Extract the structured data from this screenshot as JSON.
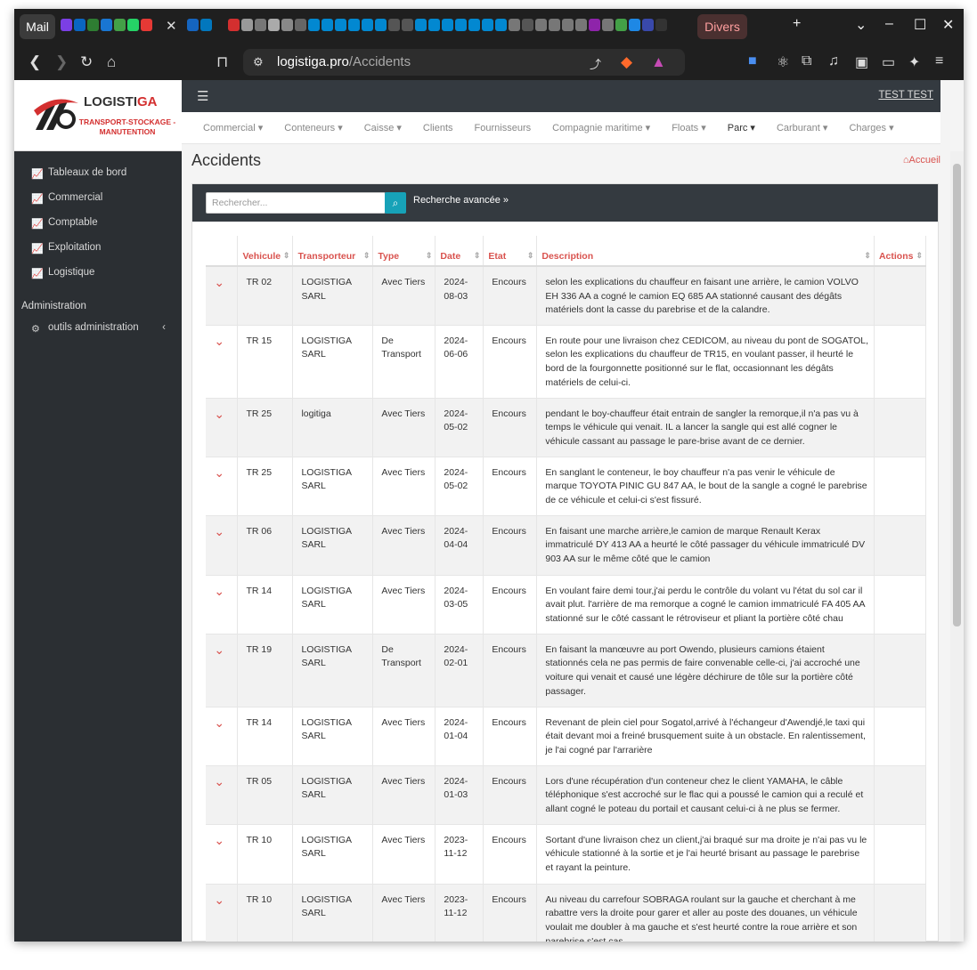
{
  "browser": {
    "tab_mail": "Mail",
    "tab_group": "Divers",
    "url_host": "logistiga.pro",
    "url_path": "/Accidents"
  },
  "app": {
    "logo_name_a": "LOGISTI",
    "logo_name_b": "GA",
    "logo_sub": "TRANSPORT-STOCKAGE -MANUTENTION",
    "user": "TEST TEST",
    "sidebar": [
      {
        "label": "Tableaux de bord"
      },
      {
        "label": "Commercial"
      },
      {
        "label": "Comptable"
      },
      {
        "label": "Exploitation"
      },
      {
        "label": "Logistique"
      }
    ],
    "admin_section": "Administration",
    "admin_item": "outils administration",
    "subnav": [
      {
        "label": "Commercial ▾"
      },
      {
        "label": "Conteneurs ▾"
      },
      {
        "label": "Caisse ▾"
      },
      {
        "label": "Clients"
      },
      {
        "label": "Fournisseurs"
      },
      {
        "label": "Compagnie maritime ▾"
      },
      {
        "label": "Floats ▾"
      },
      {
        "label": "Parc ▾"
      },
      {
        "label": "Carburant ▾"
      },
      {
        "label": "Charges ▾"
      }
    ],
    "page_title": "Accidents",
    "home_link": "Accueil",
    "search_placeholder": "Rechercher...",
    "advanced_search": "Recherche avancée »"
  },
  "table": {
    "headers": [
      "Vehicule",
      "Transporteur",
      "Type",
      "Date",
      "Etat",
      "Description",
      "Actions"
    ],
    "rows": [
      {
        "vehicule": "TR 02",
        "transporteur": "LOGISTIGA SARL",
        "type": "Avec Tiers",
        "date": "2024-08-03",
        "etat": "Encours",
        "description": "selon les explications du chauffeur en faisant une arrière, le camion VOLVO EH 336 AA a cogné le camion EQ 685 AA stationné causant des dégâts matériels dont la casse du parebrise et de la calandre."
      },
      {
        "vehicule": "TR 15",
        "transporteur": "LOGISTIGA SARL",
        "type": "De Transport",
        "date": "2024-06-06",
        "etat": "Encours",
        "description": "En route pour une livraison chez CEDICOM, au niveau du pont de SOGATOL, selon les explications du chauffeur de TR15, en voulant passer, il heurté le bord de la fourgonnette positionné sur le flat, occasionnant les dégâts matériels de celui-ci."
      },
      {
        "vehicule": "TR 25",
        "transporteur": "logitiga",
        "type": "Avec Tiers",
        "date": "2024-05-02",
        "etat": "Encours",
        "description": "pendant le boy-chauffeur était entrain de sangler la remorque,il n'a pas vu à temps le véhicule qui venait. IL a lancer la sangle qui est allé cogner le véhicule cassant au passage le pare-brise avant de ce dernier."
      },
      {
        "vehicule": "TR 25",
        "transporteur": "LOGISTIGA SARL",
        "type": "Avec Tiers",
        "date": "2024-05-02",
        "etat": "Encours",
        "description": "En sanglant le conteneur, le boy chauffeur n'a pas venir le véhicule de marque TOYOTA PINIC GU 847 AA, le bout de la sangle a cogné le parebrise de ce véhicule et celui-ci s'est fissuré."
      },
      {
        "vehicule": "TR 06",
        "transporteur": "LOGISTIGA SARL",
        "type": "Avec Tiers",
        "date": "2024-04-04",
        "etat": "Encours",
        "description": "En faisant une marche arrière,le camion de marque Renault Kerax immatriculé DY 413 AA a heurté le côté passager du véhicule immatriculé DV 903 AA sur le même côté que le camion"
      },
      {
        "vehicule": "TR 14",
        "transporteur": "LOGISTIGA SARL",
        "type": "Avec Tiers",
        "date": "2024-03-05",
        "etat": "Encours",
        "description": "En voulant faire demi tour,j'ai perdu le contrôle du volant vu l'état du sol car il avait plut. l'arrière de ma remorque a cogné le camion immatriculé FA 405 AA stationné sur le côté cassant le rétroviseur et pliant la portière côté chau"
      },
      {
        "vehicule": "TR 19",
        "transporteur": "LOGISTIGA SARL",
        "type": "De Transport",
        "date": "2024-02-01",
        "etat": "Encours",
        "description": "En faisant la manœuvre au port Owendo, plusieurs camions étaient stationnés cela ne pas permis de faire convenable celle-ci, j'ai accroché une voiture qui venait et causé une légère déchirure de tôle sur la portière côté passager."
      },
      {
        "vehicule": "TR 14",
        "transporteur": "LOGISTIGA SARL",
        "type": "Avec Tiers",
        "date": "2024-01-04",
        "etat": "Encours",
        "description": "Revenant de plein ciel pour Sogatol,arrivé à l'échangeur d'Awendjé,le taxi qui était devant moi a freiné brusquement suite à un obstacle. En ralentissement, je l'ai cogné par l'arrarière"
      },
      {
        "vehicule": "TR 05",
        "transporteur": "LOGISTIGA SARL",
        "type": "Avec Tiers",
        "date": "2024-01-03",
        "etat": "Encours",
        "description": "Lors d'une récupération d'un conteneur chez le client YAMAHA, le câble téléphonique s'est accroché sur le flac qui a poussé le camion qui a reculé et allant cogné le poteau du portail et causant celui-ci à ne plus se fermer."
      },
      {
        "vehicule": "TR 10",
        "transporteur": "LOGISTIGA SARL",
        "type": "Avec Tiers",
        "date": "2023-11-12",
        "etat": "Encours",
        "description": "Sortant d'une livraison chez un client,j'ai braqué sur ma droite je n'ai pas vu le véhicule stationné à la sortie et je l'ai heurté brisant au passage le parebrise et rayant la peinture."
      },
      {
        "vehicule": "TR 10",
        "transporteur": "LOGISTIGA SARL",
        "type": "Avec Tiers",
        "date": "2023-11-12",
        "etat": "Encours",
        "description": "Au niveau du carrefour SOBRAGA roulant sur la gauche et cherchant à me rabattre vers la droite pour garer et aller au poste des douanes, un véhicule voulait me doubler à ma gauche et s'est heurté contre la roue arrière et son parebrise s'est cas"
      }
    ]
  }
}
